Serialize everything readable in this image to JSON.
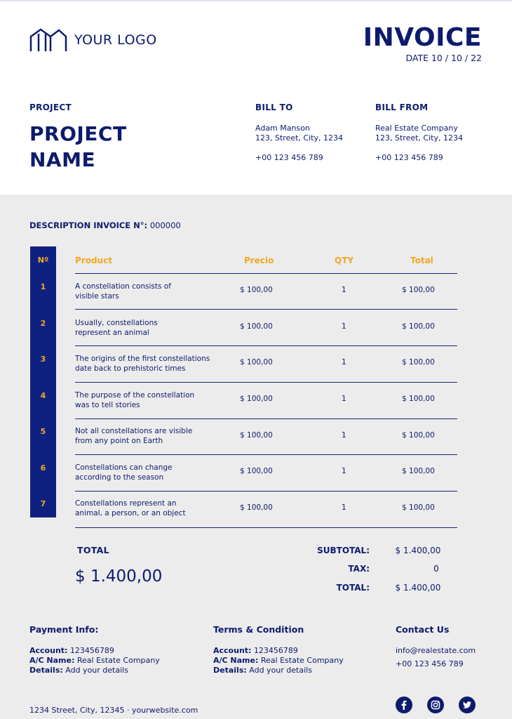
{
  "header": {
    "logo_text": "YOUR LOGO",
    "title": "INVOICE",
    "date": "DATE  10 / 10 / 22"
  },
  "project": {
    "label": "PROJECT",
    "name_line1": "PROJECT",
    "name_line2": "NAME"
  },
  "bill_to": {
    "label": "BILL TO",
    "name": "Adam Manson",
    "address": "123, Street, City, 1234",
    "phone": "+00 123 456 789"
  },
  "bill_from": {
    "label": "BILL FROM",
    "name": "Real Estate Company",
    "address": "123, Street, City, 1234",
    "phone": "+00 123 456 789"
  },
  "description": {
    "label": "DESCRIPTION INVOICE N°:",
    "number": "000000"
  },
  "table": {
    "headers": {
      "num": "Nº",
      "product": "Product",
      "price": "Precio",
      "qty": "QTY",
      "total": "Total"
    },
    "rows": [
      {
        "num": "1",
        "line1": "A constellation consists of",
        "line2": "visible stars",
        "price": "$ 100,00",
        "qty": "1",
        "total": "$ 100,00"
      },
      {
        "num": "2",
        "line1": "Usually, constellations",
        "line2": "represent an animal",
        "price": "$ 100,00",
        "qty": "1",
        "total": "$ 100,00"
      },
      {
        "num": "3",
        "line1": "The origins of the first constellations",
        "line2": "date back to prehistoric times",
        "price": "$ 100,00",
        "qty": "1",
        "total": "$ 100,00"
      },
      {
        "num": "4",
        "line1": "The purpose of the constellation",
        "line2": "was to tell stories",
        "price": "$ 100,00",
        "qty": "1",
        "total": "$ 100,00"
      },
      {
        "num": "5",
        "line1": "Not all constellations are visible",
        "line2": "from any point on Earth",
        "price": "$ 100,00",
        "qty": "1",
        "total": "$ 100,00"
      },
      {
        "num": "6",
        "line1": "Constellations can change",
        "line2": "according to the season",
        "price": "$ 100,00",
        "qty": "1",
        "total": "$ 100,00"
      },
      {
        "num": "7",
        "line1": "Constellations represent an",
        "line2": "animal, a person, or an object",
        "price": "$ 100,00",
        "qty": "1",
        "total": "$ 100,00"
      }
    ]
  },
  "totals": {
    "total_label": "TOTAL",
    "total_value": "$ 1.400,00",
    "subtotal_label": "SUBTOTAL:",
    "subtotal_value": "$ 1.400,00",
    "tax_label": "TAX:",
    "tax_value": "0",
    "grand_label": "TOTAL:",
    "grand_value": "$ 1.400,00"
  },
  "footer": {
    "payment": {
      "title": "Payment Info:",
      "account_label": "Account:",
      "account_value": "123456789",
      "ac_name_label": "A/C Name:",
      "ac_name_value": "Real Estate Company",
      "details_label": "Details:",
      "details_value": "Add your details"
    },
    "terms": {
      "title": "Terms & Condition",
      "account_label": "Account:",
      "account_value": "123456789",
      "ac_name_label": "A/C Name:",
      "ac_name_value": "Real Estate Company",
      "details_label": "Details:",
      "details_value": "Add your details"
    },
    "contact": {
      "title": "Contact Us",
      "email": "info@realestate.com",
      "phone": "+00 123 456 789"
    },
    "address_line": "1234 Street, City, 12345  ·  yourwebsite.com",
    "social_icons": [
      "facebook-icon",
      "instagram-icon",
      "twitter-icon"
    ]
  },
  "colors": {
    "navy": "#0d1b6e",
    "accent": "#f5a623",
    "background": "#ececec"
  }
}
